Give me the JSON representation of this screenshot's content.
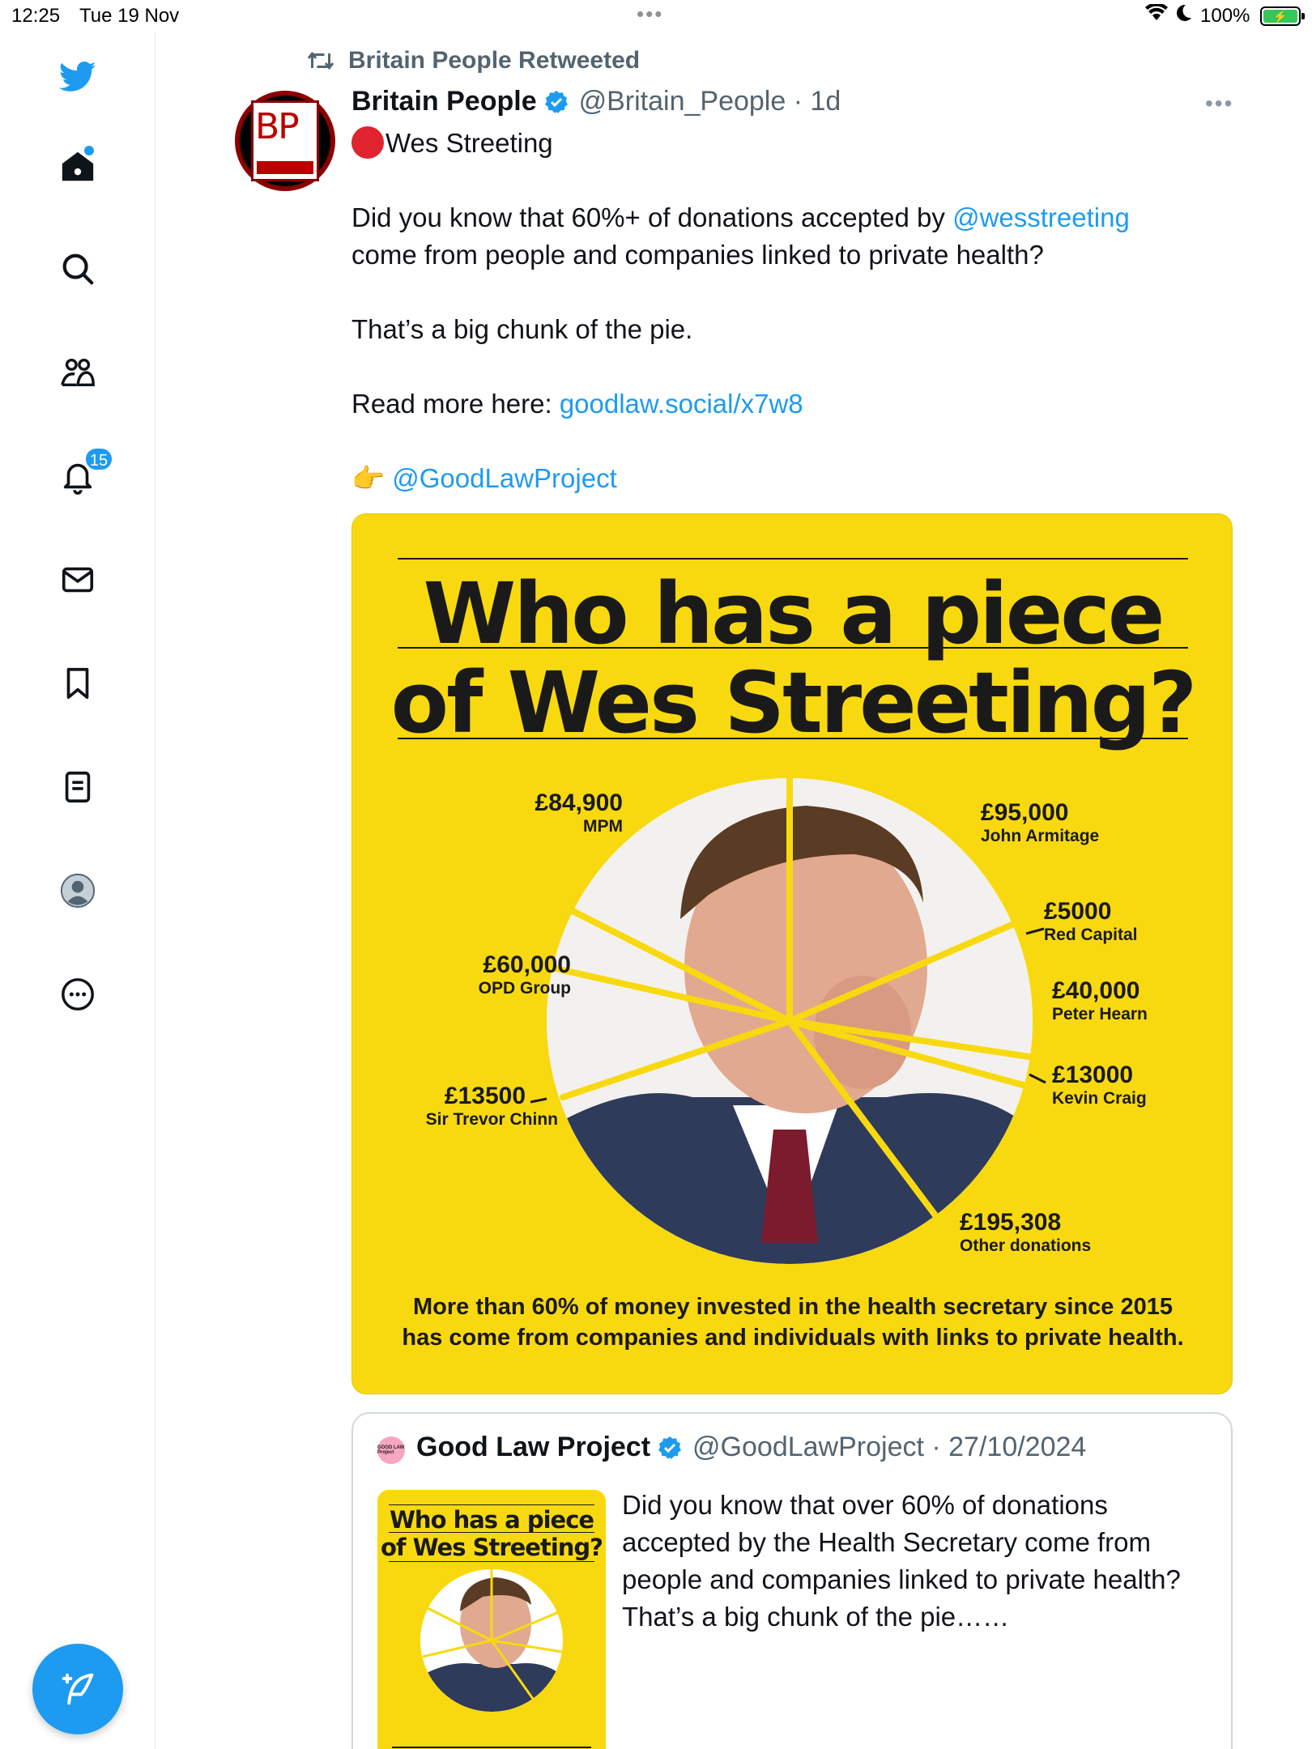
{
  "status_bar": {
    "time": "12:25",
    "date": "Tue 19 Nov",
    "battery": "100%"
  },
  "sidebar": {
    "notifications_count": "15"
  },
  "tweet": {
    "retweeted_by": "Britain People Retweeted",
    "author_name": "Britain People",
    "author_handle": "@Britain_People · 1d",
    "avatar_text": "BP",
    "line1": "Wes Streeting",
    "line2_a": "Did you know that 60%+ of donations accepted by ",
    "line2_mention": "@wesstreeting",
    "line2_b": "come from people and companies linked to private health?",
    "line3": "That’s a big chunk of the pie.",
    "line4_a": "Read more here: ",
    "line4_link": "goodlaw.social/x7w8",
    "line5_emoji": "👉",
    "line5_mention": "@GoodLawProject"
  },
  "image": {
    "title_line1": "Who has a piece",
    "title_line2": "of Wes Streeting?",
    "footer_line1": "More than 60% of money invested in the health secretary since 2015",
    "footer_line2": "has come from companies and individuals with links to private health.",
    "labels": [
      {
        "amount": "£84,900",
        "who": "MPM"
      },
      {
        "amount": "£95,000",
        "who": "John Armitage"
      },
      {
        "amount": "£5000",
        "who": "Red Capital"
      },
      {
        "amount": "£60,000",
        "who": "OPD Group"
      },
      {
        "amount": "£40,000",
        "who": "Peter Hearn"
      },
      {
        "amount": "£13000",
        "who": "Kevin Craig"
      },
      {
        "amount": "£13500",
        "who": "Sir Trevor Chinn"
      },
      {
        "amount": "£195,308",
        "who": "Other donations"
      }
    ],
    "colors": {
      "background": "#f8d90f",
      "ink": "#1a1a1a"
    }
  },
  "quoted_tweet": {
    "author_name": "Good Law Project",
    "author_handle": "@GoodLawProject · 27/10/2024",
    "avatar_text": "GOOD LAW Project",
    "text": "Did you know that over 60% of donations accepted by the Health Secretary come from people and companies linked to private health? That’s a big chunk of the pie……",
    "thumb_title1": "Who has a piece",
    "thumb_title2": "of Wes Streeting?"
  },
  "colors": {
    "accent": "#1d9bf0",
    "muted": "#536471"
  }
}
